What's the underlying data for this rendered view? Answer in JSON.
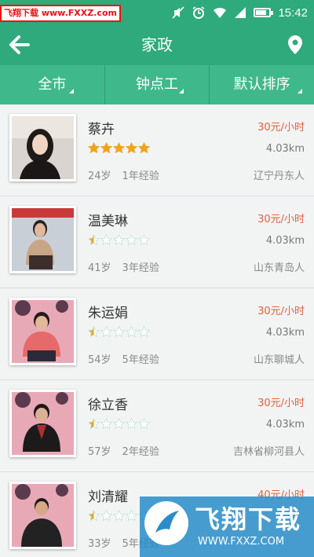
{
  "status_bar": {
    "watermark": "飞翔下载 www.FXXZ.com",
    "time": "15:42",
    "battery_level": 0.8
  },
  "app_bar": {
    "title": "家政",
    "back_icon": "arrow-left-icon",
    "location_icon": "map-pin-icon"
  },
  "filters": [
    {
      "label": "全市"
    },
    {
      "label": "钟点工"
    },
    {
      "label": "默认排序"
    }
  ],
  "workers": [
    {
      "name": "蔡卉",
      "rating": 5,
      "age": "24岁",
      "experience": "1年经验",
      "price": "30元/小时",
      "distance": "4.03km",
      "origin": "辽宁丹东人"
    },
    {
      "name": "温美琳",
      "rating": 0.5,
      "age": "41岁",
      "experience": "3年经验",
      "price": "30元/小时",
      "distance": "4.03km",
      "origin": "山东青岛人"
    },
    {
      "name": "朱运娟",
      "rating": 0.5,
      "age": "54岁",
      "experience": "5年经验",
      "price": "30元/小时",
      "distance": "4.03km",
      "origin": "山东聊城人"
    },
    {
      "name": "徐立香",
      "rating": 0.5,
      "age": "57岁",
      "experience": "2年经验",
      "price": "30元/小时",
      "distance": "4.03km",
      "origin": "吉林省柳河县人"
    },
    {
      "name": "刘清耀",
      "rating": 0.5,
      "age": "33岁",
      "experience": "5年经验",
      "price": "40元/小时",
      "distance": "",
      "origin": ""
    }
  ],
  "bottom_watermark": {
    "title": "飞翔下载",
    "url": "WWW.FXXZ.COM"
  },
  "colors": {
    "primary": "#2eaa7c",
    "filter_bar": "#3fb98b",
    "price": "#e8603a",
    "star": "#f4a21a"
  }
}
